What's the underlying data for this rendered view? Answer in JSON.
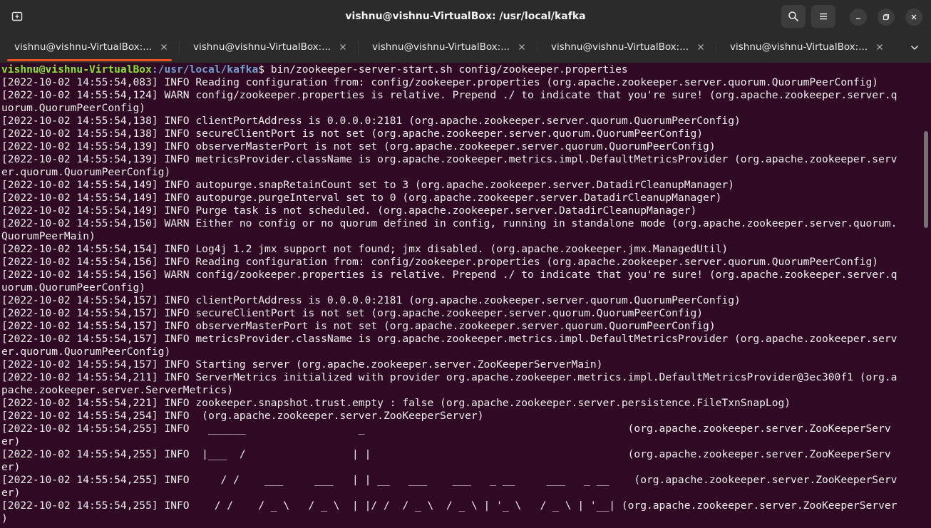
{
  "window": {
    "title": "vishnu@vishnu-VirtualBox: /usr/local/kafka"
  },
  "icons": {
    "new_tab": "new-tab-icon",
    "search": "search-icon",
    "menu": "hamburger-menu-icon",
    "minimize": "minimize-icon",
    "maximize": "maximize-icon",
    "close": "close-icon",
    "tab_close": "close-icon",
    "tabs_dropdown": "chevron-down-icon"
  },
  "colors": {
    "terminal_bg": "#300a24",
    "prompt_user": "#8ae234",
    "prompt_path": "#729fcf",
    "active_tab_indicator": "#e95420"
  },
  "tabs": [
    {
      "label": "vishnu@vishnu-VirtualBox:..."
    },
    {
      "label": "vishnu@vishnu-VirtualBox:..."
    },
    {
      "label": "vishnu@vishnu-VirtualBox:..."
    },
    {
      "label": "vishnu@vishnu-VirtualBox:..."
    },
    {
      "label": "vishnu@vishnu-VirtualBox:..."
    }
  ],
  "terminal": {
    "prompt": {
      "user_host": "vishnu@vishnu-VirtualBox",
      "path": ":/usr/local/kafka",
      "symbol": "$ ",
      "command": "bin/zookeeper-server-start.sh config/zookeeper.properties"
    },
    "lines": [
      "[2022-10-02 14:55:54,083] INFO Reading configuration from: config/zookeeper.properties (org.apache.zookeeper.server.quorum.QuorumPeerConfig)",
      "[2022-10-02 14:55:54,124] WARN config/zookeeper.properties is relative. Prepend ./ to indicate that you're sure! (org.apache.zookeeper.server.q",
      "uorum.QuorumPeerConfig)",
      "[2022-10-02 14:55:54,138] INFO clientPortAddress is 0.0.0.0:2181 (org.apache.zookeeper.server.quorum.QuorumPeerConfig)",
      "[2022-10-02 14:55:54,138] INFO secureClientPort is not set (org.apache.zookeeper.server.quorum.QuorumPeerConfig)",
      "[2022-10-02 14:55:54,139] INFO observerMasterPort is not set (org.apache.zookeeper.server.quorum.QuorumPeerConfig)",
      "[2022-10-02 14:55:54,139] INFO metricsProvider.className is org.apache.zookeeper.metrics.impl.DefaultMetricsProvider (org.apache.zookeeper.serv",
      "er.quorum.QuorumPeerConfig)",
      "[2022-10-02 14:55:54,149] INFO autopurge.snapRetainCount set to 3 (org.apache.zookeeper.server.DatadirCleanupManager)",
      "[2022-10-02 14:55:54,149] INFO autopurge.purgeInterval set to 0 (org.apache.zookeeper.server.DatadirCleanupManager)",
      "[2022-10-02 14:55:54,149] INFO Purge task is not scheduled. (org.apache.zookeeper.server.DatadirCleanupManager)",
      "[2022-10-02 14:55:54,150] WARN Either no config or no quorum defined in config, running in standalone mode (org.apache.zookeeper.server.quorum.",
      "QuorumPeerMain)",
      "[2022-10-02 14:55:54,154] INFO Log4j 1.2 jmx support not found; jmx disabled. (org.apache.zookeeper.jmx.ManagedUtil)",
      "[2022-10-02 14:55:54,156] INFO Reading configuration from: config/zookeeper.properties (org.apache.zookeeper.server.quorum.QuorumPeerConfig)",
      "[2022-10-02 14:55:54,156] WARN config/zookeeper.properties is relative. Prepend ./ to indicate that you're sure! (org.apache.zookeeper.server.q",
      "uorum.QuorumPeerConfig)",
      "[2022-10-02 14:55:54,157] INFO clientPortAddress is 0.0.0.0:2181 (org.apache.zookeeper.server.quorum.QuorumPeerConfig)",
      "[2022-10-02 14:55:54,157] INFO secureClientPort is not set (org.apache.zookeeper.server.quorum.QuorumPeerConfig)",
      "[2022-10-02 14:55:54,157] INFO observerMasterPort is not set (org.apache.zookeeper.server.quorum.QuorumPeerConfig)",
      "[2022-10-02 14:55:54,157] INFO metricsProvider.className is org.apache.zookeeper.metrics.impl.DefaultMetricsProvider (org.apache.zookeeper.serv",
      "er.quorum.QuorumPeerConfig)",
      "[2022-10-02 14:55:54,157] INFO Starting server (org.apache.zookeeper.server.ZooKeeperServerMain)",
      "[2022-10-02 14:55:54,211] INFO ServerMetrics initialized with provider org.apache.zookeeper.metrics.impl.DefaultMetricsProvider@3ec300f1 (org.a",
      "pache.zookeeper.server.ServerMetrics)",
      "[2022-10-02 14:55:54,221] INFO zookeeper.snapshot.trust.empty : false (org.apache.zookeeper.server.persistence.FileTxnSnapLog)",
      "[2022-10-02 14:55:54,254] INFO  (org.apache.zookeeper.server.ZooKeeperServer)",
      "[2022-10-02 14:55:54,255] INFO   ______                  _                                          (org.apache.zookeeper.server.ZooKeeperServ",
      "er)",
      "[2022-10-02 14:55:54,255] INFO  |___  /                 | |                                         (org.apache.zookeeper.server.ZooKeeperServ",
      "er)",
      "[2022-10-02 14:55:54,255] INFO     / /    ___     ___   | | __   ___    ___   _ __     ___   _ __    (org.apache.zookeeper.server.ZooKeeperServ",
      "er)",
      "[2022-10-02 14:55:54,255] INFO    / /    / _ \\   / _ \\  | |/ /  / _ \\  / _ \\ | '_ \\   / _ \\ | '__| (org.apache.zookeeper.server.ZooKeeperServer",
      ")"
    ]
  }
}
